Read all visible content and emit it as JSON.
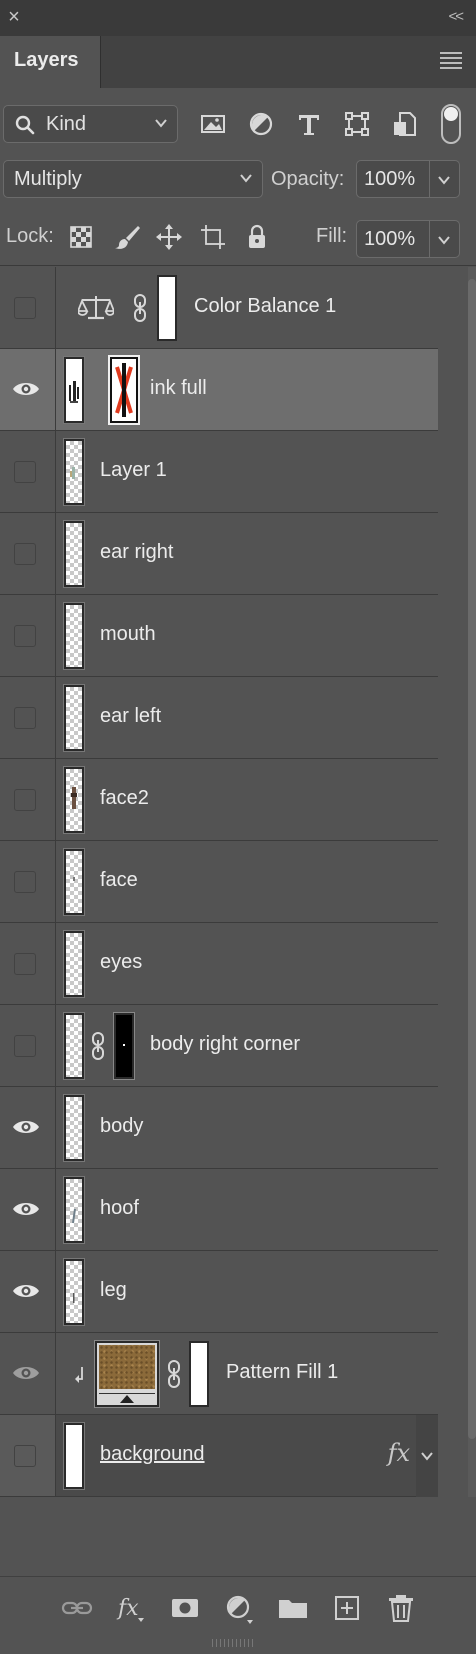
{
  "window": {
    "close_glyph": "×",
    "collapse_glyph": "<<"
  },
  "panel": {
    "tab_label": "Layers",
    "menu_icon": "hamburger-menu-icon"
  },
  "filter": {
    "kind_label": "Kind",
    "filter_icons": [
      "image-filter-icon",
      "adjustment-filter-icon",
      "type-filter-icon",
      "shape-filter-icon",
      "smart-object-filter-icon"
    ]
  },
  "blend": {
    "mode": "Multiply",
    "opacity_label": "Opacity:",
    "opacity_value": "100%"
  },
  "lock": {
    "label": "Lock:",
    "icons": [
      "lock-transparent-pixels-icon",
      "lock-image-pixels-icon",
      "lock-position-icon",
      "lock-artboard-icon",
      "lock-all-icon"
    ],
    "fill_label": "Fill:",
    "fill_value": "100%"
  },
  "layers": [
    {
      "name": "Color Balance 1",
      "visible": false,
      "type": "adjustment"
    },
    {
      "name": "ink full",
      "visible": true,
      "type": "masked",
      "selected": true
    },
    {
      "name": "Layer 1",
      "visible": false,
      "type": "pixel"
    },
    {
      "name": "ear right",
      "visible": false,
      "type": "pixel"
    },
    {
      "name": "mouth",
      "visible": false,
      "type": "pixel"
    },
    {
      "name": "ear left",
      "visible": false,
      "type": "pixel"
    },
    {
      "name": "face2",
      "visible": false,
      "type": "pixel"
    },
    {
      "name": "face",
      "visible": false,
      "type": "pixel"
    },
    {
      "name": "eyes",
      "visible": false,
      "type": "pixel"
    },
    {
      "name": "body right corner",
      "visible": false,
      "type": "masked"
    },
    {
      "name": "body",
      "visible": true,
      "type": "pixel"
    },
    {
      "name": "hoof",
      "visible": true,
      "type": "pixel"
    },
    {
      "name": "leg",
      "visible": true,
      "type": "pixel"
    },
    {
      "name": "Pattern Fill 1",
      "visible": true,
      "type": "fill",
      "clipped": true,
      "dimmed": true
    },
    {
      "name": "background",
      "visible": false,
      "type": "pixel",
      "fx": "fx"
    }
  ],
  "bottom_icons": [
    "link-layers-icon",
    "layer-style-icon",
    "add-mask-icon",
    "new-adjustment-icon",
    "new-group-icon",
    "new-layer-icon",
    "delete-layer-icon"
  ],
  "colors": {
    "panel": "#535353",
    "selected_row": "#6e6e6e",
    "title": "#3a3a3a"
  }
}
